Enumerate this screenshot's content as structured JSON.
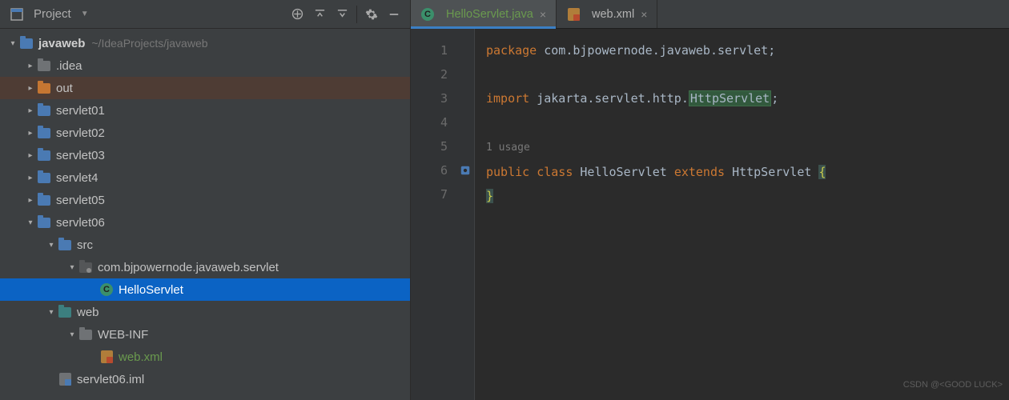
{
  "sidebar": {
    "title": "Project",
    "root_name": "javaweb",
    "root_path": "~/IdeaProjects/javaweb",
    "items": [
      {
        "name": ".idea"
      },
      {
        "name": "out"
      },
      {
        "name": "servlet01"
      },
      {
        "name": "servlet02"
      },
      {
        "name": "servlet03"
      },
      {
        "name": "servlet4"
      },
      {
        "name": "servlet05"
      },
      {
        "name": "servlet06"
      },
      {
        "name": "src"
      },
      {
        "name": "com.bjpowernode.javaweb.servlet"
      },
      {
        "name": "HelloServlet"
      },
      {
        "name": "web"
      },
      {
        "name": "WEB-INF"
      },
      {
        "name": "web.xml"
      },
      {
        "name": "servlet06.iml"
      }
    ]
  },
  "tabs": [
    {
      "label": "HelloServlet.java",
      "active": true
    },
    {
      "label": "web.xml",
      "active": false
    }
  ],
  "gutter": [
    "1",
    "2",
    "3",
    "4",
    "",
    "5",
    "6",
    "7"
  ],
  "code": {
    "package_kw": "package",
    "package_val": "com.bjpowernode.javaweb.servlet",
    "import_kw": "import",
    "import_val": "jakarta.servlet.http.",
    "import_cls": "HttpServlet",
    "usage": "1 usage",
    "public_kw": "public",
    "class_kw": "class",
    "class_name": "HelloServlet",
    "extends_kw": "extends",
    "super_cls": "HttpServlet",
    "lbrace": "{",
    "rbrace": "}"
  },
  "watermark": "CSDN @<GOOD LUCK>"
}
